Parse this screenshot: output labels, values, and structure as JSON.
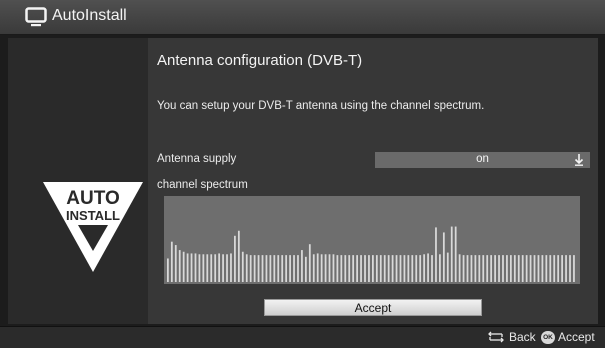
{
  "app": {
    "title": "AutoInstall",
    "icon": "tv-icon"
  },
  "logo": {
    "line1": "AUTO",
    "line2": "INSTALL"
  },
  "page": {
    "heading": "Antenna configuration (DVB-T)",
    "description": "You can setup your DVB-T antenna using the channel spectrum."
  },
  "antenna_supply": {
    "label": "Antenna supply",
    "value": "on",
    "icon": "chevron-down-icon"
  },
  "spectrum": {
    "label": "channel spectrum",
    "levels": [
      0.28,
      0.48,
      0.44,
      0.38,
      0.36,
      0.34,
      0.34,
      0.34,
      0.33,
      0.33,
      0.33,
      0.33,
      0.33,
      0.34,
      0.33,
      0.33,
      0.34,
      0.55,
      0.61,
      0.36,
      0.33,
      0.32,
      0.32,
      0.32,
      0.32,
      0.32,
      0.32,
      0.32,
      0.32,
      0.32,
      0.32,
      0.32,
      0.32,
      0.32,
      0.38,
      0.3,
      0.45,
      0.33,
      0.34,
      0.33,
      0.33,
      0.33,
      0.33,
      0.32,
      0.32,
      0.32,
      0.32,
      0.32,
      0.32,
      0.32,
      0.32,
      0.32,
      0.32,
      0.32,
      0.32,
      0.32,
      0.32,
      0.32,
      0.32,
      0.32,
      0.32,
      0.32,
      0.32,
      0.32,
      0.32,
      0.33,
      0.34,
      0.32,
      0.65,
      0.33,
      0.59,
      0.35,
      0.66,
      0.66,
      0.33,
      0.32,
      0.32,
      0.32,
      0.32,
      0.32,
      0.32,
      0.32,
      0.32,
      0.32,
      0.32,
      0.32,
      0.32,
      0.32,
      0.32,
      0.32,
      0.32,
      0.32,
      0.32,
      0.32,
      0.32,
      0.32,
      0.32,
      0.32,
      0.32,
      0.32,
      0.32,
      0.32,
      0.32,
      0.32
    ]
  },
  "accept_button": {
    "label": "Accept"
  },
  "footer": {
    "back": {
      "label": "Back",
      "icon": "back-arrows-icon"
    },
    "accept": {
      "label": "Accept",
      "key": "OK",
      "icon": "ok-key-icon"
    }
  },
  "colors": {
    "bar": "#d9d9d9",
    "spectrum_bg": "#6e6e6e",
    "content_bg": "#373737"
  }
}
